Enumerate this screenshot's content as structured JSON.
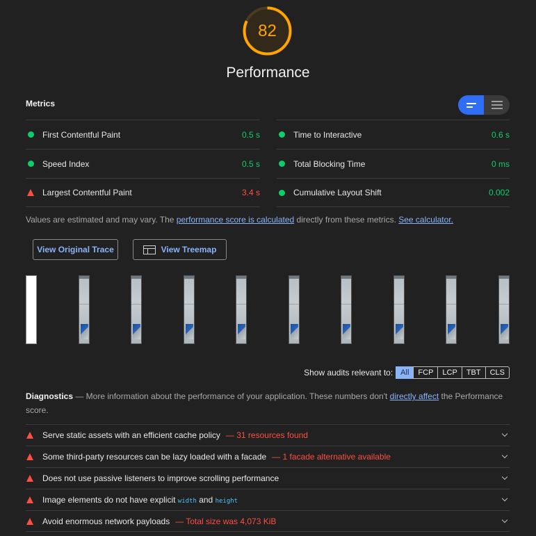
{
  "gauge": {
    "score": "82",
    "fraction": 0.82,
    "title": "Performance",
    "color": "#ffa400"
  },
  "metrics": {
    "title": "Metrics",
    "left": [
      {
        "label": "First Contentful Paint",
        "value": "0.5 s",
        "status": "pass"
      },
      {
        "label": "Speed Index",
        "value": "0.5 s",
        "status": "pass"
      },
      {
        "label": "Largest Contentful Paint",
        "value": "3.4 s",
        "status": "fail"
      }
    ],
    "right": [
      {
        "label": "Time to Interactive",
        "value": "0.6 s",
        "status": "pass"
      },
      {
        "label": "Total Blocking Time",
        "value": "0 ms",
        "status": "pass"
      },
      {
        "label": "Cumulative Layout Shift",
        "value": "0.002",
        "status": "pass"
      }
    ]
  },
  "note": {
    "prefix": "Values are estimated and may vary. The ",
    "link1": "performance score is calculated",
    "middle": " directly from these metrics. ",
    "link2": "See calculator."
  },
  "buttons": {
    "trace": "View Original Trace",
    "treemap": "View Treemap"
  },
  "filmstrip": {
    "frames": 10
  },
  "filter": {
    "label": "Show audits relevant to:",
    "options": [
      "All",
      "FCP",
      "LCP",
      "TBT",
      "CLS"
    ],
    "active": "All"
  },
  "diagnostics": {
    "title": "Diagnostics",
    "desc_before": " — More information about the performance of your application. These numbers don't ",
    "desc_link": "directly affect",
    "desc_after": " the Performance score.",
    "audits": [
      {
        "title": "Serve static assets with an efficient cache policy",
        "extra": "— 31 resources found"
      },
      {
        "title": "Some third-party resources can be lazy loaded with a facade",
        "extra": "— 1 facade alternative available"
      },
      {
        "title": "Does not use passive listeners to improve scrolling performance",
        "extra": ""
      },
      {
        "title_parts": [
          "Image elements do not have explicit ",
          "width",
          " and ",
          "height"
        ],
        "extra": ""
      },
      {
        "title": "Avoid enormous network payloads",
        "extra": "— Total size was 4,073 KiB"
      }
    ]
  },
  "colors": {
    "pass": "#0cce6b",
    "fail": "#ff4e42",
    "average": "#ffa400",
    "link": "#8ab4f8",
    "accent": "#2f6ef5"
  }
}
